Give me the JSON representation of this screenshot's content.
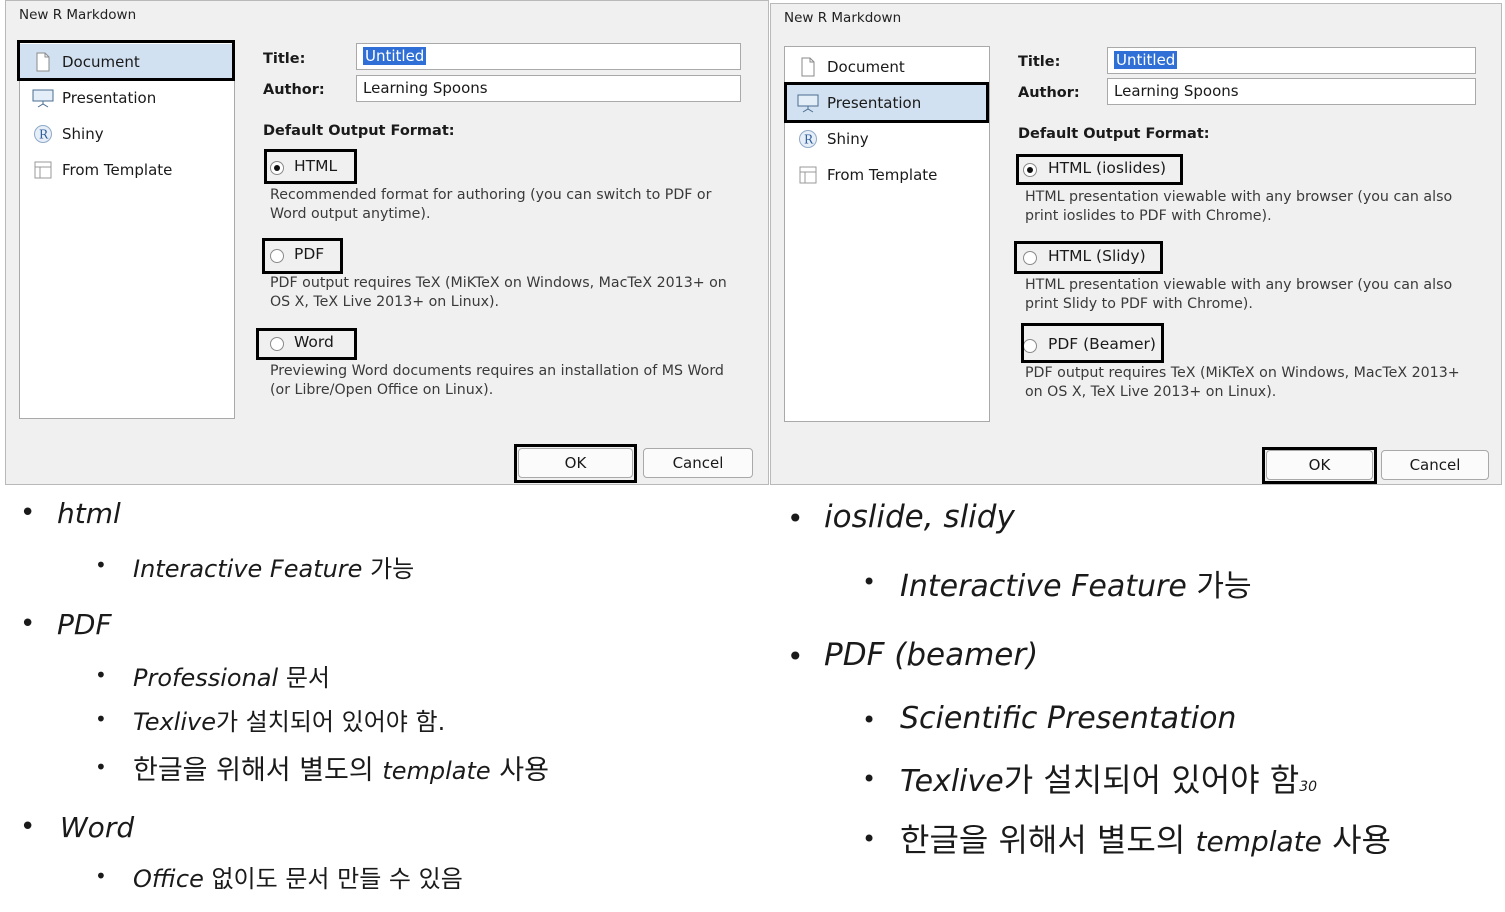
{
  "left_dialog": {
    "title": "New R Markdown",
    "types": [
      {
        "label": "Document",
        "icon": "document-icon"
      },
      {
        "label": "Presentation",
        "icon": "presentation-icon"
      },
      {
        "label": "Shiny",
        "icon": "shiny-r-icon"
      },
      {
        "label": "From Template",
        "icon": "template-icon"
      }
    ],
    "selected_type": "Document",
    "title_label": "Title:",
    "title_value": "Untitled",
    "author_label": "Author:",
    "author_value": "Learning Spoons",
    "default_format_label": "Default Output Format:",
    "options": [
      {
        "label": "HTML",
        "checked": true,
        "desc": "Recommended format for authoring (you can switch to PDF or Word output anytime)."
      },
      {
        "label": "PDF",
        "checked": false,
        "desc": "PDF output requires TeX (MiKTeX on Windows, MacTeX 2013+ on OS X, TeX Live 2013+ on Linux)."
      },
      {
        "label": "Word",
        "checked": false,
        "desc": "Previewing Word documents requires an installation of MS Word (or Libre/Open Office on Linux)."
      }
    ],
    "ok": "OK",
    "cancel": "Cancel"
  },
  "right_dialog": {
    "title": "New R Markdown",
    "types": [
      {
        "label": "Document",
        "icon": "document-icon"
      },
      {
        "label": "Presentation",
        "icon": "presentation-icon"
      },
      {
        "label": "Shiny",
        "icon": "shiny-r-icon"
      },
      {
        "label": "From Template",
        "icon": "template-icon"
      }
    ],
    "selected_type": "Presentation",
    "title_label": "Title:",
    "title_value": "Untitled",
    "author_label": "Author:",
    "author_value": "Learning Spoons",
    "default_format_label": "Default Output Format:",
    "options": [
      {
        "label": "HTML (ioslides)",
        "checked": true,
        "desc": "HTML presentation viewable with any browser (you can also print ioslides to PDF with Chrome)."
      },
      {
        "label": "HTML (Slidy)",
        "checked": false,
        "desc": "HTML presentation viewable with any browser (you can also print Slidy to PDF with Chrome)."
      },
      {
        "label": "PDF (Beamer)",
        "checked": false,
        "desc": "PDF output requires TeX (MiKTeX on Windows, MacTeX 2013+ on OS X, TeX Live 2013+ on Linux)."
      }
    ],
    "ok": "OK",
    "cancel": "Cancel"
  },
  "left_notes": {
    "html": "html",
    "html_sub1_a": "Interactive Feature",
    "html_sub1_b": " 가능",
    "pdf": "PDF",
    "pdf_sub1_a": "Professional",
    "pdf_sub1_b": " 문서",
    "pdf_sub2_a": "Texlive",
    "pdf_sub2_b": "가 설치되어 있어야 함.",
    "pdf_sub3_a": "한글을 위해서 별도의 ",
    "pdf_sub3_b": "template",
    "pdf_sub3_c": " 사용",
    "word": "Word",
    "word_sub1_a": "Office",
    "word_sub1_b": " 없이도 문서 만들 수 있음"
  },
  "right_notes": {
    "ioslide": "ioslide, slidy",
    "io_sub1_a": "Interactive Feature",
    "io_sub1_b": " 가능",
    "beamer": "PDF (beamer)",
    "beamer_sub1": "Scientific Presentation",
    "beamer_sub2_a": "Texlive",
    "beamer_sub2_b": "가 설치되어 있어야 함",
    "page_number": "30",
    "beamer_sub3_a": "한글을 위해서 별도의 ",
    "beamer_sub3_b": "template",
    "beamer_sub3_c": " 사용"
  }
}
